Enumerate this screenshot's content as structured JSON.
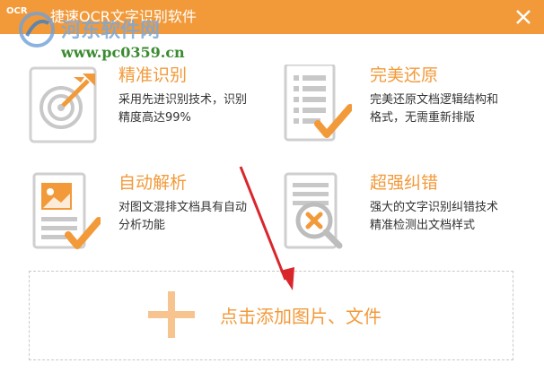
{
  "window": {
    "title": "捷速OCR文字识别软件"
  },
  "watermark": {
    "brand": "河东软件网",
    "url": "www.pc0359.cn"
  },
  "features": [
    {
      "title": "精准识别",
      "desc_line1": "采用先进识别技术，识别",
      "desc_line2": "精度高达99%",
      "icon": "target-icon"
    },
    {
      "title": "完美还原",
      "desc_line1": "完美还原文档逻辑结构和",
      "desc_line2": "格式，无需重新排版",
      "icon": "document-check-icon"
    },
    {
      "title": "自动解析",
      "desc_line1": "对图文混排文档具有自动",
      "desc_line2": "分析功能",
      "icon": "image-document-icon"
    },
    {
      "title": "超强纠错",
      "desc_line1": "强大的文字识别纠错技术",
      "desc_line2": "精准检测出文档样式",
      "icon": "magnifier-error-icon"
    }
  ],
  "drop_zone": {
    "label": "点击添加图片、文件"
  },
  "colors": {
    "accent": "#f29a3a",
    "arrow": "#d9262c",
    "icon_gray": "#c8c8c8"
  }
}
